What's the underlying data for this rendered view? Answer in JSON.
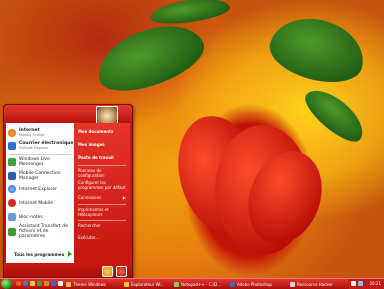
{
  "start_menu": {
    "pinned": [
      {
        "label": "Internet",
        "sublabel": "Mozilla Firefox",
        "icon": "firefox-icon",
        "color": "#e8640f"
      },
      {
        "label": "Courrier électronique",
        "sublabel": "Outlook Express",
        "icon": "mail-icon",
        "color": "#2b6cd6"
      }
    ],
    "recent": [
      {
        "label": "Windows Live Messenger",
        "icon": "messenger-icon",
        "color": "#3aa33a"
      },
      {
        "label": "Mobile Connection Manager",
        "icon": "mobile-icon",
        "color": "#2a5fb0"
      },
      {
        "label": "Internet Explorer",
        "icon": "ie-icon",
        "color": "#2f7fe0"
      },
      {
        "label": "Internet Mobile",
        "icon": "globe-icon",
        "color": "#d8281e"
      },
      {
        "label": "Bloc-notes",
        "icon": "notepad-icon",
        "color": "#6c9cd8"
      },
      {
        "label": "Assistant Transfert de fichiers et de paramètres",
        "icon": "transfer-icon",
        "color": "#3a9a3a"
      }
    ],
    "all_programs": "Tous les programmes",
    "right": [
      {
        "label": "Mes documents"
      },
      {
        "label": "Mes images"
      },
      {
        "label": "Poste de travail"
      },
      {
        "label": "Panneau de configuration"
      },
      {
        "label": "Configurer les programmes par défaut"
      },
      {
        "label": "Connexions"
      },
      {
        "label": "Imprimantes et télécopieurs"
      },
      {
        "label": "Rechercher"
      },
      {
        "label": "Exécuter..."
      }
    ]
  },
  "taskbar": {
    "tasks": [
      {
        "label": "Theme Windows",
        "icon": "folder-icon",
        "color": "#f0c040"
      },
      {
        "label": "Explorateur Wi...",
        "icon": "explorer-icon",
        "color": "#f0c040"
      },
      {
        "label": "Notepad++ - C:\\D...",
        "icon": "notepad-plus-icon",
        "color": "#8bcf5a"
      },
      {
        "label": "Adobe Photoshop",
        "icon": "photoshop-icon",
        "color": "#2a6ab8"
      },
      {
        "label": "Ressource Hacker",
        "icon": "gear-icon",
        "color": "#d0d0d0"
      }
    ],
    "clock": "20:21"
  }
}
